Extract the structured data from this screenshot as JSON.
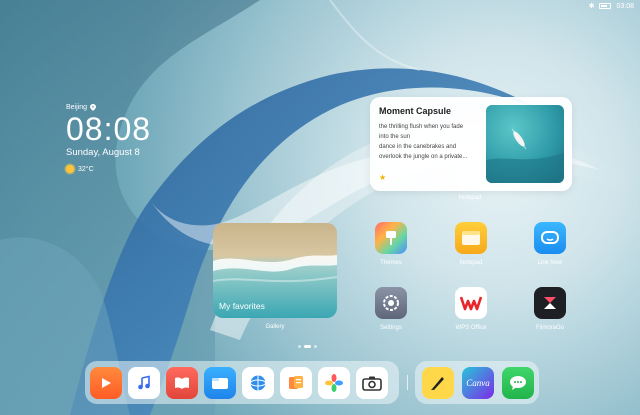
{
  "status_bar": {
    "time": "03:08"
  },
  "clock_widget": {
    "city": "Beijing",
    "time": "08:08",
    "date": "Sunday, August 8",
    "temperature": "32°C"
  },
  "notepad_widget": {
    "title": "Moment Capsule",
    "body_lines": [
      "the thrilling flush when you fade",
      "into the sun",
      "dance in the canebrakes and",
      "overlook the jungle on a private..."
    ],
    "label": "Notepad"
  },
  "gallery_widget": {
    "caption": "My favorites",
    "label": "Gallery"
  },
  "apps": [
    {
      "label": "Themes",
      "icon": "themes-icon"
    },
    {
      "label": "Notepad",
      "icon": "notepad-icon"
    },
    {
      "label": "Link Now",
      "icon": "link-now-icon"
    },
    {
      "label": "Settings",
      "icon": "settings-icon"
    },
    {
      "label": "WPS Office",
      "icon": "wps-office-icon"
    },
    {
      "label": "FilmoraGo",
      "icon": "filmorago-icon"
    }
  ],
  "dock": {
    "main_apps": [
      "video-icon",
      "music-icon",
      "books-icon",
      "files-icon",
      "browser-icon",
      "docs-icon",
      "photos-icon",
      "camera-icon"
    ],
    "side_apps": [
      "pen-app-icon",
      "canva-icon",
      "messages-icon"
    ],
    "canva_text": "Canva"
  },
  "colors": {
    "wallpaper_light": "#e8f3f6",
    "wallpaper_dark": "#4d8fa4",
    "star": "#f0b400"
  }
}
